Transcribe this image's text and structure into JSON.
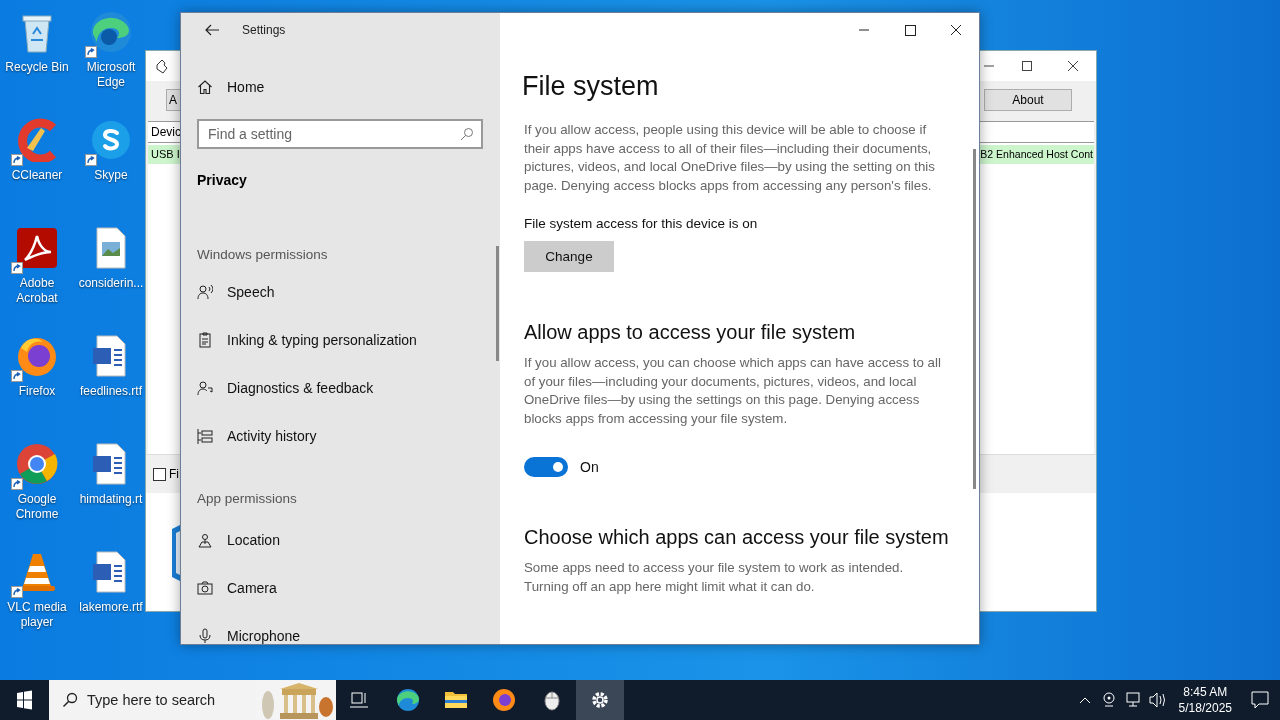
{
  "desktop": {
    "icons": [
      {
        "label": "Recycle Bin",
        "kind": "recycle-bin",
        "shortcut": false
      },
      {
        "label": "Microsoft Edge",
        "kind": "edge",
        "shortcut": true
      },
      {
        "label": "CCleaner",
        "kind": "ccleaner",
        "shortcut": true
      },
      {
        "label": "Skype",
        "kind": "skype",
        "shortcut": true
      },
      {
        "label": "Adobe Acrobat",
        "kind": "acrobat",
        "shortcut": true
      },
      {
        "label": "considerin...",
        "kind": "image-file",
        "shortcut": false
      },
      {
        "label": "Firefox",
        "kind": "firefox",
        "shortcut": true
      },
      {
        "label": "feedlines.rtf",
        "kind": "word-file",
        "shortcut": false
      },
      {
        "label": "Google Chrome",
        "kind": "chrome",
        "shortcut": true
      },
      {
        "label": "himdating.rt",
        "kind": "word-file",
        "shortcut": false
      },
      {
        "label": "VLC media player",
        "kind": "vlc",
        "shortcut": true
      },
      {
        "label": "lakemore.rtf",
        "kind": "word-file",
        "shortcut": false
      }
    ]
  },
  "background_window": {
    "toolbar_button": "A",
    "about_button": "About",
    "column_1": "Devic",
    "row": {
      "cell_1": "USB I",
      "cell_2": "B2 Enhanced Host Cont"
    },
    "checkbox": {
      "label": "Fi",
      "checked": false
    }
  },
  "settings": {
    "window": {
      "title": "Settings"
    },
    "sidebar": {
      "home": "Home",
      "search": {
        "placeholder": "Find a setting"
      },
      "section": "Privacy",
      "groups": [
        {
          "heading": "Windows permissions",
          "items": [
            {
              "label": "Speech",
              "kind": "speech",
              "selected": false
            },
            {
              "label": "Inking & typing personalization",
              "kind": "inking",
              "selected": false
            },
            {
              "label": "Diagnostics & feedback",
              "kind": "diagnostics",
              "selected": false
            },
            {
              "label": "Activity history",
              "kind": "activity",
              "selected": false
            }
          ]
        },
        {
          "heading": "App permissions",
          "items": [
            {
              "label": "Location",
              "kind": "location",
              "selected": false
            },
            {
              "label": "Camera",
              "kind": "camera",
              "selected": false
            },
            {
              "label": "Microphone",
              "kind": "microphone",
              "selected": false
            }
          ]
        }
      ]
    },
    "content": {
      "title": "File system",
      "sections": [
        {
          "kind": "device",
          "text": "If you allow access, people using this device will be able to choose if their apps have access to all of their files—including their documents, pictures, videos, and local OneDrive files—by using the setting on this page. Denying access blocks apps from accessing any person's files.",
          "status": "File system access for this device is on",
          "button": "Change"
        },
        {
          "kind": "toggle",
          "heading": "Allow apps to access your file system",
          "text": "If you allow access, you can choose which apps can have access to all of your files—including your documents, pictures, videos, and local OneDrive files—by using the settings on this page. Denying access blocks apps from accessing your file system.",
          "toggle": {
            "on": true,
            "label": "On"
          }
        },
        {
          "kind": "info",
          "heading": "Choose which apps can access your file system",
          "text": "Some apps need to access your file system to work as intended. Turning off an app here might limit what it can do."
        }
      ]
    }
  },
  "taskbar": {
    "search": {
      "placeholder": "Type here to search"
    },
    "apps": [
      {
        "kind": "task-view",
        "active": false
      },
      {
        "kind": "edge",
        "active": false
      },
      {
        "kind": "explorer",
        "active": false
      },
      {
        "kind": "firefox",
        "active": false
      },
      {
        "kind": "mouse-app",
        "active": false
      },
      {
        "kind": "settings",
        "active": true
      }
    ],
    "time": "8:45 AM",
    "date": "5/18/2025"
  }
}
